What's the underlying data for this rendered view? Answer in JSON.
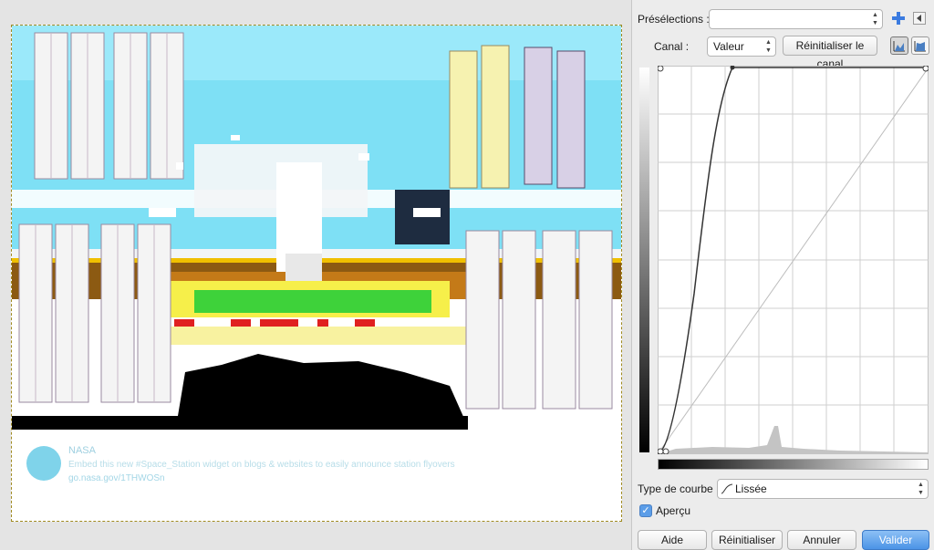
{
  "presets": {
    "label": "Présélections :",
    "value": ""
  },
  "channel": {
    "label": "Canal :",
    "value": "Valeur",
    "reset_label": "Réinitialiser le canal"
  },
  "curve_type": {
    "label": "Type de courbe :",
    "value": "Lissée"
  },
  "preview": {
    "label": "Aperçu",
    "checked": true
  },
  "buttons": {
    "help": "Aide",
    "reset": "Réinitialiser",
    "cancel": "Annuler",
    "ok": "Valider"
  },
  "tweet": {
    "author": "NASA",
    "text": "Embed this new #Space_Station widget on blogs & websites to easily announce station flyovers",
    "link": "go.nasa.gov/1THWOSn"
  },
  "colors": {
    "accent": "#4b93e6",
    "sky": "#7ee0f5"
  },
  "icons": [
    "add-preset-icon",
    "collapse-icon",
    "linear-histogram-icon",
    "log-histogram-icon",
    "smooth-curve-icon",
    "checkmark-icon",
    "nasa-logo"
  ]
}
